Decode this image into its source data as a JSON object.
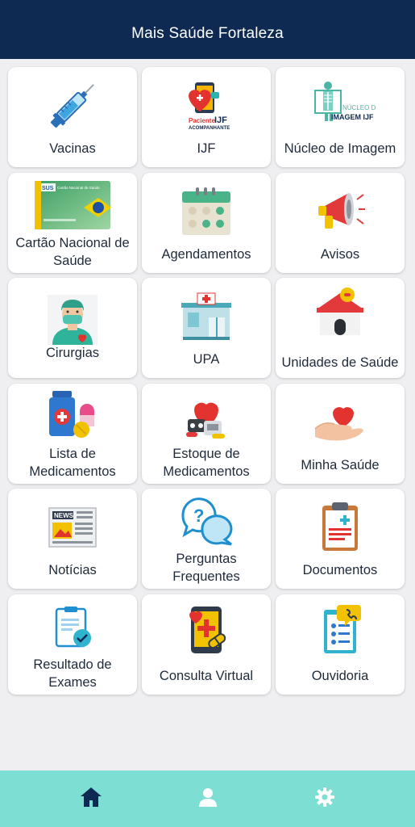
{
  "header": {
    "title": "Mais Saúde Fortaleza"
  },
  "tiles": [
    {
      "label": "Vacinas",
      "icon": "syringe-icon"
    },
    {
      "label": "IJF",
      "icon": "ijf-logo-icon",
      "logo_text": [
        "Paciente",
        "IJF",
        "ACOMPANHANTE"
      ]
    },
    {
      "label": "Núcleo de Imagem",
      "icon": "imaging-icon",
      "logo_text": [
        "NÚCLEO DE",
        "IMAGEM IJF"
      ]
    },
    {
      "label": "Cartão Nacional de Saúde",
      "icon": "health-card-icon",
      "logo_text": [
        "SUS",
        "Cartão Nacional de Saúde"
      ]
    },
    {
      "label": "Agendamentos",
      "icon": "calendar-icon"
    },
    {
      "label": "Avisos",
      "icon": "megaphone-icon"
    },
    {
      "label": "Cirurgias",
      "icon": "surgeon-icon"
    },
    {
      "label": "UPA",
      "icon": "clinic-building-icon"
    },
    {
      "label": "Unidades de Saúde",
      "icon": "health-unit-icon"
    },
    {
      "label": "Lista de Medicamentos",
      "icon": "medicine-bottle-icon"
    },
    {
      "label": "Estoque de Medicamentos",
      "icon": "medicine-stock-icon"
    },
    {
      "label": "Minha Saúde",
      "icon": "heart-hand-icon"
    },
    {
      "label": "Notícias",
      "icon": "newspaper-icon",
      "logo_text": [
        "NEWS"
      ]
    },
    {
      "label": "Perguntas Frequentes",
      "icon": "faq-chat-icon"
    },
    {
      "label": "Documentos",
      "icon": "clipboard-icon"
    },
    {
      "label": "Resultado de Exames",
      "icon": "exam-result-icon"
    },
    {
      "label": "Consulta Virtual",
      "icon": "virtual-consult-icon"
    },
    {
      "label": "Ouvidoria",
      "icon": "ombudsman-icon"
    }
  ],
  "bottom_nav": [
    {
      "name": "home",
      "icon": "home-icon",
      "active": true
    },
    {
      "name": "profile",
      "icon": "user-icon",
      "active": false
    },
    {
      "name": "settings",
      "icon": "gear-icon",
      "active": false
    }
  ],
  "colors": {
    "header_bg": "#0e2a52",
    "bottom_bar_bg": "#7ddfd4",
    "nav_icon": "#0e2a52",
    "nav_icon_inactive": "#ffffff",
    "page_bg": "#efeff1"
  }
}
